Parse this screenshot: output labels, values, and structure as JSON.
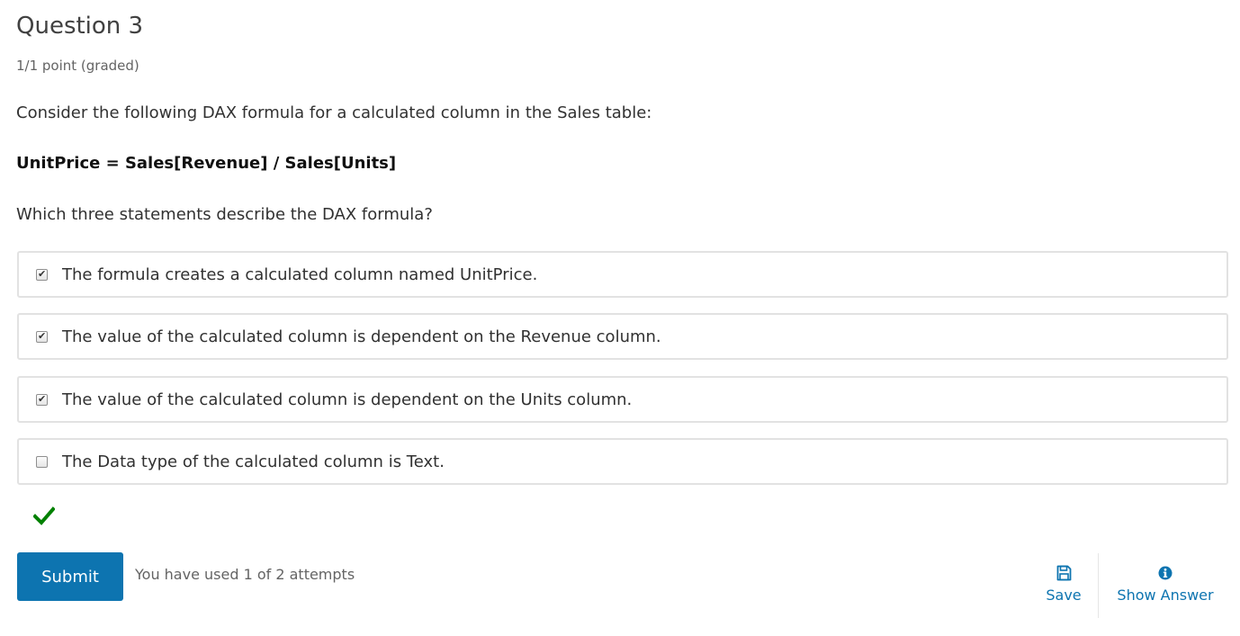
{
  "question": {
    "title": "Question 3",
    "score": "1/1 point (graded)",
    "prompt_intro": "Consider the following DAX formula for a calculated column in the Sales table:",
    "formula": "UnitPrice = Sales[Revenue] / Sales[Units]",
    "prompt_question": "Which three statements describe the DAX formula?"
  },
  "choices": [
    {
      "label": "The formula creates a calculated column named UnitPrice.",
      "checked": true
    },
    {
      "label": "The value of the calculated column is dependent on the Revenue column.",
      "checked": true
    },
    {
      "label": "The value of the calculated column is dependent on the Units column.",
      "checked": true
    },
    {
      "label": "The Data type of the calculated column is Text.",
      "checked": false
    }
  ],
  "result": {
    "status": "correct",
    "icon": "checkmark-icon",
    "color": "#008100"
  },
  "actions": {
    "submit_label": "Submit",
    "attempts_text": "You have used 1 of 2 attempts",
    "save_label": "Save",
    "show_answer_label": "Show Answer"
  },
  "colors": {
    "accent": "#0d74b0",
    "correct": "#008100",
    "choice_border": "#e2e2e2"
  }
}
